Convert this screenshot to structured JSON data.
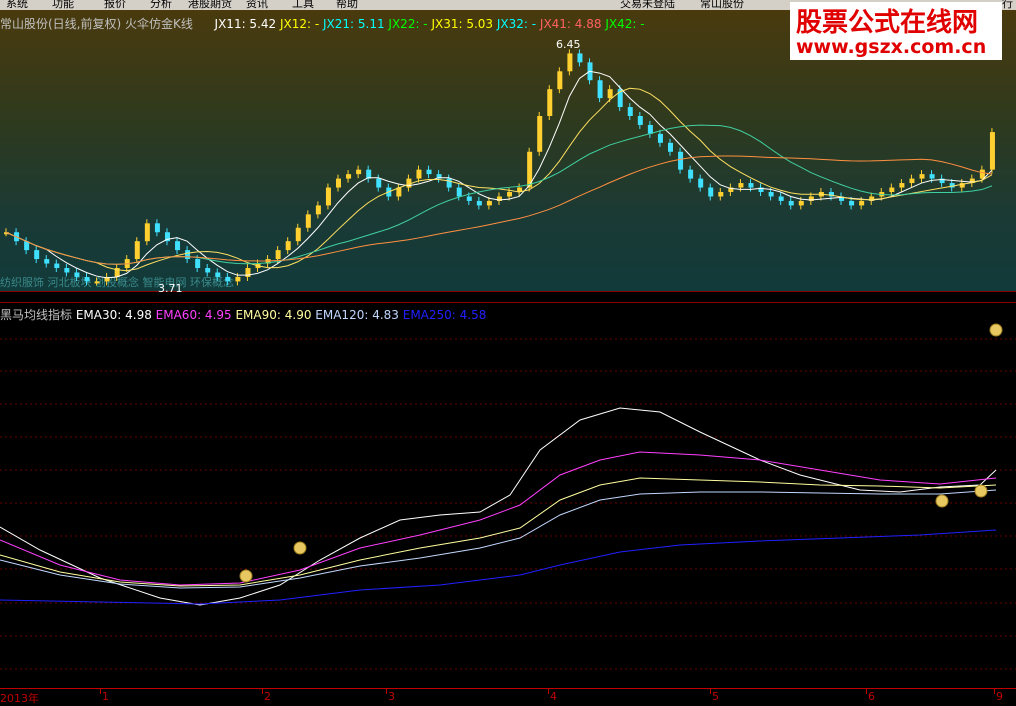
{
  "menubar": {
    "items": [
      "系统",
      "功能",
      "报价",
      "分析",
      "港股期货",
      "资讯",
      "工具",
      "帮助"
    ],
    "right_items": [
      "交易未登陆",
      "常山股份"
    ],
    "corner": "行"
  },
  "kline_panel": {
    "stock_title": "常山股份(日线,前复权)",
    "indicator_name": "火伞仿金K线",
    "indicators": [
      {
        "label": "JX11: 5.42",
        "color": "#ffffff"
      },
      {
        "label": "JX12: -",
        "color": "#ffff00"
      },
      {
        "label": "JX21: 5.11",
        "color": "#00ffff"
      },
      {
        "label": "JX22: -",
        "color": "#00ff00"
      },
      {
        "label": "JX31: 5.03",
        "color": "#ffff00"
      },
      {
        "label": "JX32: -",
        "color": "#00ffff"
      },
      {
        "label": "JX41: 4.88",
        "color": "#ff6060"
      },
      {
        "label": "JX42: -",
        "color": "#00ff00"
      }
    ],
    "high_label": "6.45",
    "low_label": "3.71",
    "concepts": "纺织服饰 河北板块 创投概念 智能电网 环保概念"
  },
  "indicator_panel": {
    "title": "黑马均线指标",
    "values": [
      {
        "label": "EMA30: 4.98",
        "color": "#ffffff"
      },
      {
        "label": "EMA60: 4.95",
        "color": "#ff40ff"
      },
      {
        "label": "EMA90: 4.90",
        "color": "#ffffa0"
      },
      {
        "label": "EMA120: 4.83",
        "color": "#c0d8ff"
      },
      {
        "label": "EMA250: 4.58",
        "color": "#2020ff"
      }
    ]
  },
  "time_axis": {
    "labels": [
      "2013年",
      "1",
      "2",
      "3",
      "4",
      "5",
      "6",
      "9"
    ]
  },
  "watermark": {
    "line1": "股票公式在线网",
    "line2": "www.gszx.com.cn"
  },
  "chart_data": {
    "type": "candlestick",
    "price_high": 6.45,
    "price_low": 3.71,
    "ohlc_close_approx": [
      4.3,
      4.2,
      4.1,
      4.0,
      3.95,
      3.9,
      3.85,
      3.8,
      3.75,
      3.75,
      3.8,
      3.9,
      4.0,
      4.2,
      4.4,
      4.3,
      4.2,
      4.1,
      4.0,
      3.9,
      3.85,
      3.8,
      3.75,
      3.8,
      3.9,
      3.95,
      4.0,
      4.1,
      4.2,
      4.35,
      4.5,
      4.6,
      4.8,
      4.9,
      4.95,
      5.0,
      4.9,
      4.8,
      4.7,
      4.8,
      4.9,
      5.0,
      4.95,
      4.9,
      4.8,
      4.7,
      4.65,
      4.6,
      4.65,
      4.7,
      4.75,
      4.8,
      5.2,
      5.6,
      5.9,
      6.1,
      6.3,
      6.2,
      6.0,
      5.8,
      5.9,
      5.7,
      5.6,
      5.5,
      5.4,
      5.3,
      5.2,
      5.0,
      4.9,
      4.8,
      4.7,
      4.75,
      4.8,
      4.85,
      4.8,
      4.75,
      4.7,
      4.65,
      4.6,
      4.65,
      4.7,
      4.75,
      4.7,
      4.65,
      4.6,
      4.65,
      4.7,
      4.75,
      4.8,
      4.85,
      4.9,
      4.95,
      4.9,
      4.85,
      4.8,
      4.85,
      4.9,
      5.0,
      5.42
    ]
  }
}
